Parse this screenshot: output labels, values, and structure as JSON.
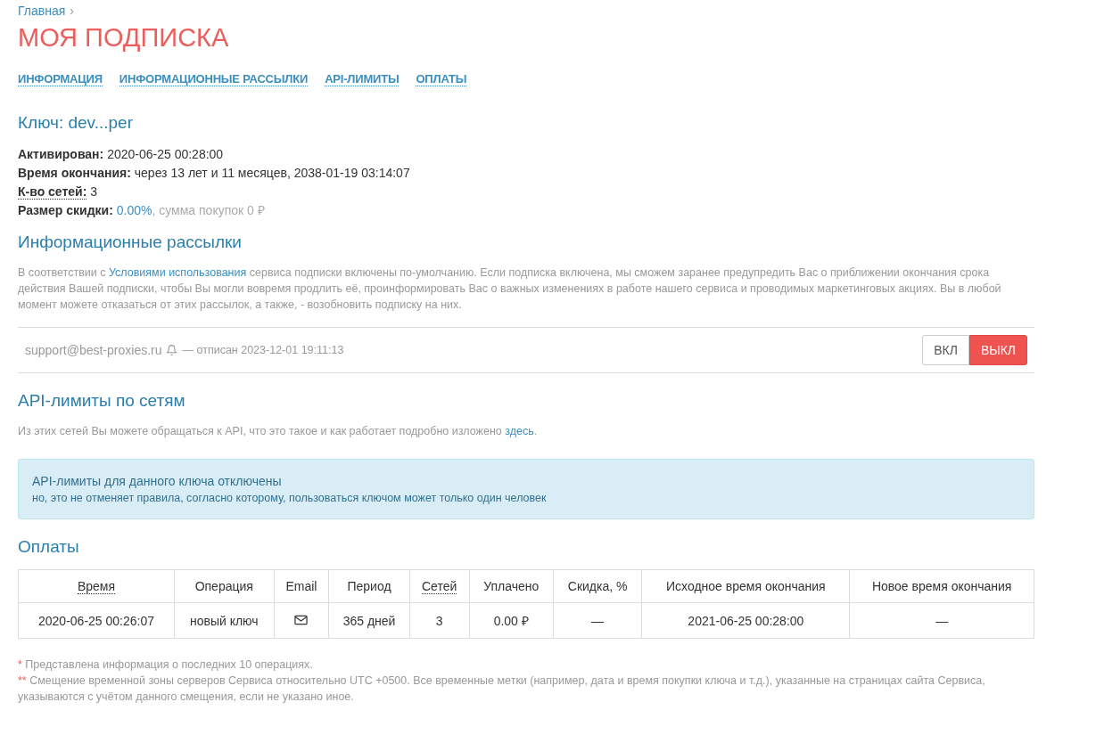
{
  "breadcrumb": {
    "link": "Главная",
    "separator": "›"
  },
  "title": "МОЯ ПОДПИСКА",
  "tabs": [
    "ИНФОРМАЦИЯ",
    "ИНФОРМАЦИОННЫЕ РАССЫЛКИ",
    "API-ЛИМИТЫ",
    "ОПЛАТЫ"
  ],
  "key_heading": "Ключ: dev...per",
  "info": [
    {
      "label": "Активирован:",
      "value": "2020-06-25 00:28:00",
      "underlined": false,
      "kind": "text"
    },
    {
      "label": "Время окончания:",
      "value": "через 13 лет и 11 месяцев, 2038-01-19 03:14:07",
      "underlined": false,
      "kind": "text"
    },
    {
      "label": "К-во сетей:",
      "value": "3",
      "underlined": true,
      "kind": "text"
    },
    {
      "label": "Размер скидки:",
      "value": "0.00%",
      "note": ", сумма покупок 0 ₽",
      "underlined": false,
      "kind": "percent"
    }
  ],
  "mailing": {
    "heading": "Информационные рассылки",
    "text_before": "В соответствии с ",
    "link": "Условиями использования",
    "text_after": " сервиса подписки включены по-умолчанию. Если подписка включена, мы сможем заранее предупредить Вас о приближении окончания срока действия Вашей подписки, чтобы Вы могли вовремя продлить её, проинформировать Вас о важных изменениях в работе нашего сервиса и проводимых маркетинговых акциях. Вы в любой момент можете отказаться от этих рассылок, а также, - возобновить подписку на них.",
    "email": "support@best-proxies.ru",
    "status": "— отписан 2023-12-01 19:11:13",
    "toggle": [
      {
        "label": "ВКЛ",
        "selected": false
      },
      {
        "label": "ВЫКЛ",
        "selected": true
      }
    ]
  },
  "api": {
    "heading": "API-лимиты по сетям",
    "text_before": "Из этих сетей Вы можете обращаться к API, что это такое и как работает подробно изложено ",
    "link": "здесь",
    "text_after": ".",
    "alert_title": "API-лимиты для данного ключа отключены",
    "alert_text": "но, это не отменяет правила, согласно которому, пользоваться ключом может только один человек"
  },
  "payments": {
    "heading": "Оплаты",
    "columns": [
      {
        "label": "Время",
        "underlined": true
      },
      {
        "label": "Операция",
        "underlined": false
      },
      {
        "label": "Email",
        "underlined": false
      },
      {
        "label": "Период",
        "underlined": false
      },
      {
        "label": "Сетей",
        "underlined": true
      },
      {
        "label": "Уплачено",
        "underlined": false
      },
      {
        "label": "Скидка, %",
        "underlined": false
      },
      {
        "label": "Исходное время окончания",
        "underlined": false
      },
      {
        "label": "Новое время окончания",
        "underlined": false
      }
    ],
    "rows": [
      [
        {
          "kind": "text",
          "text": "2020-06-25 00:26:07"
        },
        {
          "kind": "text",
          "text": "новый ключ"
        },
        {
          "kind": "mail"
        },
        {
          "kind": "text",
          "text": "365 дней"
        },
        {
          "kind": "text",
          "text": "3"
        },
        {
          "kind": "text",
          "text": "0.00 ₽"
        },
        {
          "kind": "text",
          "text": "—"
        },
        {
          "kind": "text",
          "text": "2021-06-25 00:28:00"
        },
        {
          "kind": "text",
          "text": "—"
        }
      ]
    ]
  },
  "footnotes": [
    {
      "mark": "*",
      "text": " Представлена информация о последних 10 операциях."
    },
    {
      "mark": "**",
      "text": " Смещение временной зоны серверов Сервиса относительно UTC +0500. Все временные метки (например, дата и время покупки ключа и т.д.), указанные на страницах сайта Сервиса, указываются с учётом данного смещения, если не указано иное."
    }
  ]
}
